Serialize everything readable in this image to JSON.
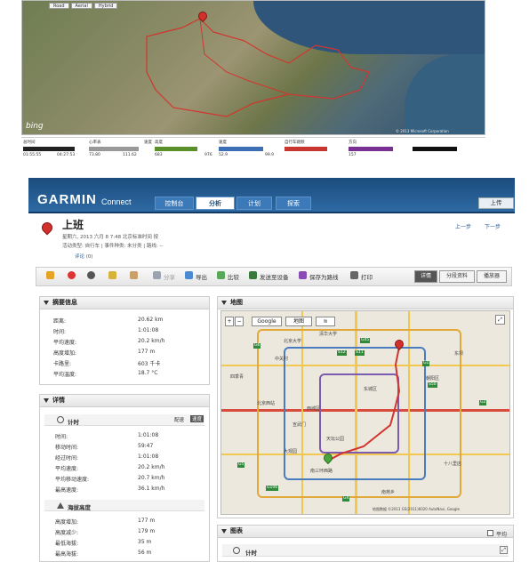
{
  "satellite": {
    "tabs": [
      "Road",
      "Aerial",
      "Hybrid"
    ],
    "brand": "bing",
    "copyright": "© 2013 Microsoft Corporation",
    "stats": [
      {
        "label": "总时间",
        "value": "01:55:55",
        "max": "",
        "color": "#222222"
      },
      {
        "label": "心率表",
        "value": "",
        "max": "04:27:53",
        "color": "#888888"
      },
      {
        "label": "速度",
        "value": "73.80",
        "max": "111.62",
        "color": "#5a8f2a"
      },
      {
        "label": "高度",
        "value": "683",
        "max": "976",
        "color": "#5a8f2a"
      },
      {
        "label": "速度",
        "value": "52.9",
        "max": "99.9",
        "color": "#3c6fb5"
      },
      {
        "label": "自行车踏频",
        "value": "",
        "max": "",
        "color": "#c8372d"
      },
      {
        "label": "方向",
        "value": "157",
        "max": "",
        "color": "#7a2f93"
      },
      {
        "label": "",
        "value": "",
        "max": "",
        "color": "#111111"
      }
    ]
  },
  "header": {
    "logo": "GARMIN",
    "logo_sub": "Connect",
    "nav": [
      "控制台",
      "分析",
      "计划",
      "探索"
    ],
    "go_button": "上传"
  },
  "activity": {
    "title": "上班",
    "date_line": "星期六, 2013 六月 8 7:48 北京标准时间 按",
    "type_line": "活动类型: 自行车 | 事件种类: 未分类 | 路线: --",
    "comments": "评论 (0)",
    "prev": "上一步",
    "next": "下一步"
  },
  "toolbar": {
    "actions": [
      "分享",
      "导出",
      "比较",
      "发送至设备",
      "保存为路线",
      "打印"
    ],
    "view_tabs": [
      "详情",
      "分段资料",
      "播放器"
    ]
  },
  "summary": {
    "title": "摘要信息",
    "rows": [
      {
        "k": "距离:",
        "v": "20.62 km"
      },
      {
        "k": "时间:",
        "v": "1:01:08"
      },
      {
        "k": "平均速度:",
        "v": "20.2 km/h"
      },
      {
        "k": "高度增加:",
        "v": "177 m"
      },
      {
        "k": "卡路里:",
        "v": "603 千卡"
      },
      {
        "k": "平均温度:",
        "v": "18.7 °C"
      }
    ]
  },
  "details": {
    "title": "详情",
    "timing_title": "计时",
    "toggle": [
      "配速",
      "速度"
    ],
    "timing_rows": [
      {
        "k": "时间:",
        "v": "1:01:08"
      },
      {
        "k": "移动时间:",
        "v": "59:47"
      },
      {
        "k": "经过时间:",
        "v": "1:01:08"
      },
      {
        "k": "平均速度:",
        "v": "20.2 km/h"
      },
      {
        "k": "平均移动速度:",
        "v": "20.7 km/h"
      },
      {
        "k": "最高速度:",
        "v": "36.1 km/h"
      }
    ],
    "elev_title": "海拔高度",
    "elev_rows": [
      {
        "k": "高度增加:",
        "v": "177 m"
      },
      {
        "k": "高度减少:",
        "v": "179 m"
      },
      {
        "k": "最低海拔:",
        "v": "35 m"
      },
      {
        "k": "最高海拔:",
        "v": "56 m"
      }
    ]
  },
  "map": {
    "title": "地图",
    "provider": "Google",
    "maptype": "地图",
    "copyright": "地图数据 ©2013 GS(2011)6020 AutoNavi, Google",
    "labels": [
      "北京西站",
      "天坛公园",
      "东城区",
      "西城区",
      "朝阳区",
      "大观园",
      "宣武门",
      "南三环西路",
      "北京大学",
      "清华大学",
      "中关村",
      "四季青",
      "东坝",
      "十八里店",
      "南苑乡"
    ],
    "shields": [
      "G6",
      "G45",
      "S12",
      "S11",
      "G1",
      "G2",
      "G4",
      "S50",
      "G5",
      "G106"
    ]
  },
  "charts": {
    "title": "图表",
    "smooth": "平均",
    "timing": "计时"
  }
}
